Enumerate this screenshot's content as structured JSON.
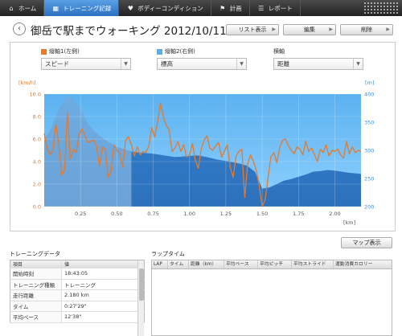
{
  "nav": {
    "tabs": [
      {
        "label": "ホーム",
        "icon": "home-icon"
      },
      {
        "label": "トレーニング記録",
        "icon": "training-icon",
        "active": true
      },
      {
        "label": "ボディーコンディション",
        "icon": "body-icon"
      },
      {
        "label": "計画",
        "icon": "flag-icon"
      },
      {
        "label": "レポート",
        "icon": "report-icon"
      }
    ]
  },
  "header": {
    "title": "御岳で駅までウォーキング 2012/10/11",
    "list_button": "リスト表示",
    "edit_button": "編集",
    "delete_button": "削除"
  },
  "controls": {
    "y1": {
      "label": "縦軸1(左側)",
      "value": "スピード",
      "color": "#f07820"
    },
    "y2": {
      "label": "縦軸2(右側)",
      "value": "標高",
      "color": "#58b0ea"
    },
    "x": {
      "label": "横軸",
      "value": "距離"
    }
  },
  "chart_data": {
    "type": "line",
    "y1_unit": "[km/h]",
    "y2_unit": "[m]",
    "x_unit": "[km]",
    "xlim": [
      0,
      2.18
    ],
    "y1lim": [
      0,
      10
    ],
    "y2lim": [
      200,
      400
    ],
    "x_ticks": [
      "0.25",
      "0.50",
      "0.75",
      "1.00",
      "1.25",
      "1.50",
      "1.75",
      "2.00"
    ],
    "y1_ticks": [
      "0.0",
      "2.0",
      "4.0",
      "6.0",
      "8.0",
      "10.0"
    ],
    "y2_ticks": [
      "200",
      "250",
      "300",
      "350",
      "400"
    ],
    "grid": true,
    "series": [
      {
        "axis": "y2",
        "kind": "area",
        "color": "#2c7fcf",
        "x": [
          0,
          0.05,
          0.1,
          0.15,
          0.2,
          0.25,
          0.3,
          0.35,
          0.4,
          0.45,
          0.5,
          0.55,
          0.6,
          0.65,
          0.7,
          0.75,
          0.8,
          0.85,
          0.9,
          0.95,
          1.0,
          1.05,
          1.1,
          1.15,
          1.2,
          1.25,
          1.3,
          1.35,
          1.4,
          1.45,
          1.5,
          1.55,
          1.6,
          1.65,
          1.7,
          1.75,
          1.8,
          1.85,
          1.9,
          1.95,
          2.0,
          2.05,
          2.1,
          2.15,
          2.18
        ],
        "values": [
          318,
          340,
          372,
          395,
          392,
          372,
          348,
          332,
          322,
          314,
          306,
          302,
          298,
          296,
          295,
          294,
          292,
          290,
          288,
          289,
          290,
          291,
          289,
          286,
          283,
          281,
          279,
          276,
          272,
          262,
          232,
          234,
          240,
          246,
          249,
          253,
          257,
          262,
          263,
          265,
          264,
          262,
          260,
          259,
          258
        ]
      },
      {
        "axis": "y1",
        "kind": "line",
        "color": "#e8782a",
        "x": [
          0,
          0.02,
          0.04,
          0.06,
          0.08,
          0.1,
          0.12,
          0.14,
          0.16,
          0.18,
          0.2,
          0.22,
          0.24,
          0.26,
          0.28,
          0.3,
          0.32,
          0.34,
          0.36,
          0.38,
          0.4,
          0.42,
          0.44,
          0.46,
          0.48,
          0.5,
          0.52,
          0.54,
          0.56,
          0.58,
          0.6,
          0.62,
          0.64,
          0.66,
          0.68,
          0.7,
          0.72,
          0.74,
          0.76,
          0.78,
          0.8,
          0.82,
          0.84,
          0.86,
          0.88,
          0.9,
          0.92,
          0.94,
          0.96,
          0.98,
          1.0,
          1.02,
          1.04,
          1.06,
          1.08,
          1.1,
          1.12,
          1.14,
          1.16,
          1.18,
          1.2,
          1.22,
          1.24,
          1.26,
          1.28,
          1.3,
          1.32,
          1.34,
          1.36,
          1.38,
          1.4,
          1.42,
          1.44,
          1.46,
          1.48,
          1.5,
          1.52,
          1.54,
          1.56,
          1.58,
          1.6,
          1.62,
          1.64,
          1.66,
          1.68,
          1.7,
          1.72,
          1.74,
          1.76,
          1.78,
          1.8,
          1.82,
          1.84,
          1.86,
          1.88,
          1.9,
          1.92,
          1.94,
          1.96,
          1.98,
          2.0,
          2.02,
          2.04,
          2.06,
          2.08,
          2.1,
          2.12,
          2.14,
          2.16,
          2.18
        ],
        "values": [
          6.5,
          5.2,
          4.6,
          5.0,
          7.3,
          5.6,
          2.8,
          3.2,
          8.3,
          4.2,
          5.1,
          4.8,
          6.4,
          6.9,
          6.3,
          5.7,
          5.8,
          5.9,
          5.4,
          3.6,
          5.3,
          5.1,
          2.6,
          3.1,
          5.5,
          5.0,
          4.7,
          3.5,
          5.9,
          6.2,
          5.5,
          4.5,
          5.3,
          4.6,
          4.9,
          4.8,
          5.4,
          7.0,
          6.2,
          7.5,
          9.2,
          8.0,
          7.2,
          6.8,
          4.9,
          5.2,
          5.8,
          4.9,
          5.5,
          4.4,
          4.6,
          5.6,
          4.1,
          3.4,
          5.1,
          5.9,
          6.3,
          5.2,
          5.0,
          5.4,
          5.7,
          4.4,
          4.9,
          5.5,
          3.5,
          2.6,
          4.5,
          4.9,
          5.1,
          0.8,
          3.8,
          4.6,
          4.0,
          3.2,
          1.8,
          0.0,
          0.6,
          2.5,
          4.4,
          4.8,
          3.9,
          5.2,
          5.9,
          6.0,
          5.4,
          5.0,
          4.7,
          5.3,
          5.1,
          4.6,
          5.8,
          4.9,
          5.2,
          4.6,
          4.0,
          5.1,
          4.8,
          5.5,
          4.5,
          5.0,
          4.9,
          5.1,
          4.6,
          4.3,
          5.8,
          4.7,
          5.3,
          4.8,
          5.0,
          4.9
        ]
      }
    ]
  },
  "map_button": "マップ表示",
  "training": {
    "label": "トレーニングデータ",
    "head": [
      "項目",
      "値"
    ],
    "rows": [
      [
        "開始時刻",
        "18:43:05"
      ],
      [
        "トレーニング種類",
        "トレーニング"
      ],
      [
        "走行距離",
        "2.180 km"
      ],
      [
        "タイム",
        "0:27'29\""
      ],
      [
        "平均ペース",
        "12'38\""
      ]
    ]
  },
  "lap": {
    "label": "ラップタイム",
    "columns": [
      "LAP",
      "タイム",
      "距離（km）",
      "平均ペース",
      "平均ピッチ",
      "平均ストライド",
      "運動消費カロリー"
    ]
  }
}
